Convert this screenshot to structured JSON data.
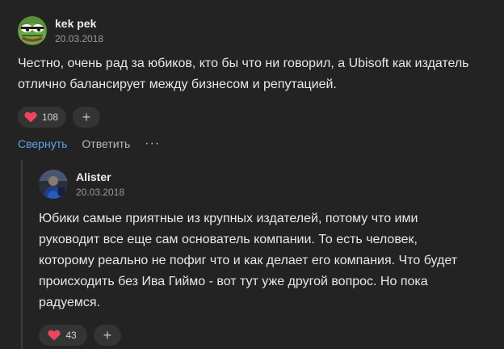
{
  "comments": [
    {
      "author": "kek pek",
      "date": "20.03.2018",
      "avatar_icon": "pepe-frog-avatar",
      "text": "Честно, очень рад за юбиков, кто бы что ни говорил, а Ubisoft как издатель отлично балансирует между бизнесом и репутацией.",
      "likes": "108",
      "add_reaction": "+"
    },
    {
      "author": "Alister",
      "date": "20.03.2018",
      "avatar_icon": "user-photo-avatar",
      "text": "Юбики самые приятные из крупных издателей, потому что ими руководит все еще сам основатель компании. То есть человек, которому реально не пофиг что и как делает его компания. Что будет происходить без Ива Гиймо - вот тут уже другой вопрос. Но пока радуемся.",
      "likes": "43",
      "add_reaction": "+"
    }
  ],
  "actions": {
    "collapse": "Свернуть",
    "reply": "Ответить",
    "more": "···"
  },
  "colors": {
    "background": "#232323",
    "link": "#5fa3ea",
    "heart": "#e8475f",
    "pill": "#343434"
  }
}
